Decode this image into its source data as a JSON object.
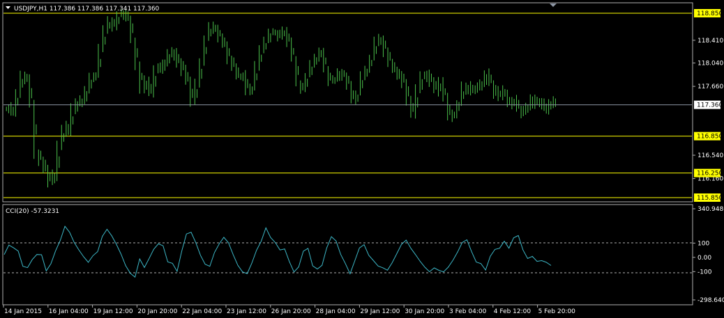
{
  "window": {
    "symbol_line": "USDJPY,H1  117.386 117.386 117.341 117.360",
    "cci_label": "CCI(20) -57.3231"
  },
  "colors": {
    "background": "#000000",
    "candles": "#4CC34C",
    "cci_line": "#3DB8C8",
    "level_lines": "#FFFF00",
    "current_price_line": "#8C95A3",
    "axis_text": "#FFFFFF",
    "border": "#B0B0B0"
  },
  "chart_data": [
    {
      "type": "bar",
      "title": "USDJPY,H1",
      "series": [
        {
          "values": [
            117.3,
            117.24,
            117.58,
            117.84,
            117.79,
            117.36,
            116.59,
            116.46,
            116.31,
            116.12,
            116.2,
            116.68,
            116.99,
            116.93,
            117.29,
            117.4,
            117.41,
            117.6,
            117.8,
            117.83,
            118.26,
            118.58,
            118.72,
            118.66,
            118.84,
            118.86,
            118.78,
            118.41,
            118.0,
            117.65,
            117.73,
            117.57,
            117.95,
            117.97,
            118.05,
            118.19,
            118.18,
            118.05,
            117.92,
            117.74,
            117.4,
            117.68,
            118.05,
            118.44,
            118.62,
            118.61,
            118.45,
            118.35,
            118.12,
            117.98,
            117.82,
            117.83,
            117.56,
            117.63,
            118.01,
            118.23,
            118.4,
            118.55,
            118.53,
            118.47,
            118.59,
            118.36,
            118.12,
            117.72,
            117.61,
            117.84,
            118.01,
            118.14,
            118.23,
            117.93,
            117.75,
            117.77,
            117.91,
            117.84,
            117.67,
            117.42,
            117.55,
            117.82,
            117.95,
            118.14,
            118.38,
            118.45,
            118.24,
            118.07,
            117.92,
            117.84,
            117.72,
            117.44,
            117.24,
            117.59,
            117.81,
            117.86,
            117.72,
            117.6,
            117.72,
            117.45,
            117.15,
            117.24,
            117.4,
            117.67,
            117.6,
            117.64,
            117.64,
            117.73,
            117.85,
            117.7,
            117.49,
            117.59,
            117.5,
            117.39,
            117.44,
            117.31,
            117.25,
            117.36,
            117.46,
            117.4,
            117.36,
            117.29,
            117.39,
            117.36
          ],
          "ylim": [
            115.85,
            118.85
          ]
        }
      ],
      "y_ticks": [
        "118.410",
        "118.040",
        "117.660",
        "116.540",
        "116.160"
      ],
      "level_labels": [
        "118.850",
        "116.850",
        "116.250",
        "115.850"
      ],
      "last_price_label": "117.360"
    },
    {
      "type": "line",
      "title": "CCI(20) -57.3231",
      "series": [
        {
          "values": [
            19,
            86,
            67,
            44,
            -63,
            -72,
            -16,
            20,
            18,
            -95,
            -45,
            46,
            119,
            218,
            176,
            103,
            51,
            4,
            -35,
            12,
            40,
            147,
            197,
            152,
            92,
            23,
            -59,
            -112,
            -139,
            -11,
            -71,
            -9,
            57,
            95,
            81,
            -32,
            -42,
            -98,
            44,
            164,
            176,
            103,
            15,
            -48,
            -63,
            34,
            94,
            141,
            102,
            19,
            -56,
            -102,
            -114,
            -40,
            50,
            113,
            207,
            140,
            104,
            52,
            59,
            -29,
            -103,
            -67,
            43,
            63,
            -60,
            -82,
            -56,
            66,
            145,
            115,
            20,
            -44,
            -115,
            -25,
            66,
            89,
            15,
            -23,
            -61,
            -73,
            -90,
            -38,
            26,
            91,
            121,
            64,
            19,
            -28,
            -69,
            -101,
            -74,
            -91,
            -102,
            -69,
            -21,
            37,
            104,
            123,
            40,
            -33,
            -44,
            -89,
            7,
            56,
            64,
            113,
            64,
            137,
            153,
            52,
            -8,
            7,
            -28,
            -23,
            -35,
            -57
          ],
          "ylim": [
            -298.6405,
            340.9486
          ]
        }
      ],
      "y_ticks": [
        "340.9486",
        "100",
        "0.00",
        "-100",
        "-298.6405"
      ],
      "levels": [
        100,
        -100
      ]
    }
  ],
  "x_axis": {
    "labels": [
      "14 Jan 2015",
      "16 Jan 04:00",
      "19 Jan 12:00",
      "20 Jan 20:00",
      "22 Jan 04:00",
      "23 Jan 12:00",
      "26 Jan 20:00",
      "28 Jan 04:00",
      "29 Jan 12:00",
      "30 Jan 20:00",
      "3 Feb 04:00",
      "4 Feb 12:00",
      "5 Feb 20:00"
    ]
  }
}
